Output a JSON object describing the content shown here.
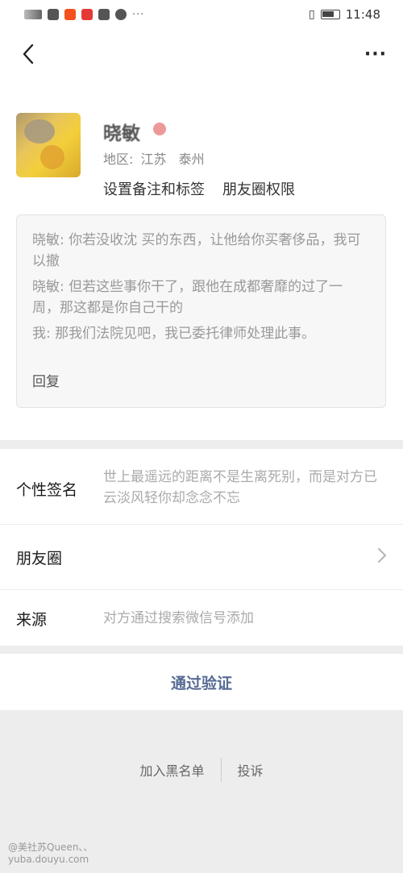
{
  "status_bar": {
    "time": "11:48",
    "icons": [
      "signal-icon",
      "wechat-icon",
      "app-icon",
      "app-icon",
      "info-icon",
      "app-icon",
      "more-dots-icon",
      "vibrate-icon",
      "battery-icon"
    ]
  },
  "nav": {
    "back_icon": "chevron-left-icon",
    "more_label": "···"
  },
  "profile": {
    "name": "晓敏",
    "region_label": "地区:",
    "region_province": "江苏",
    "region_city": "泰州",
    "action_remarks": "设置备注和标签",
    "action_moments_permission": "朋友圈权限"
  },
  "message_card": {
    "lines": [
      "晓敏: 你若没收沈  买的东西，让他给你买奢侈品，我可以撤",
      "晓敏: 但若这些事你干了，跟他在成都奢靡的过了一周，那这都是你自己干的",
      "我: 那我们法院见吧，我已委托律师处理此事。"
    ],
    "reply": "回复"
  },
  "info": {
    "signature_label": "个性签名",
    "signature_value": "世上最遥远的距离不是生离死别，而是对方已云淡风轻你却念念不忘",
    "moments_label": "朋友圈",
    "source_label": "来源",
    "source_value": "对方通过搜索微信号添加"
  },
  "verify_button": "通过验证",
  "bottom": {
    "blacklist": "加入黑名单",
    "report": "投诉"
  },
  "watermark": {
    "line1": "@美社苏Queen、、",
    "line2": "yuba.douyu.com"
  },
  "colors": {
    "link_blue": "#576b95",
    "background_gray": "#ededed"
  }
}
